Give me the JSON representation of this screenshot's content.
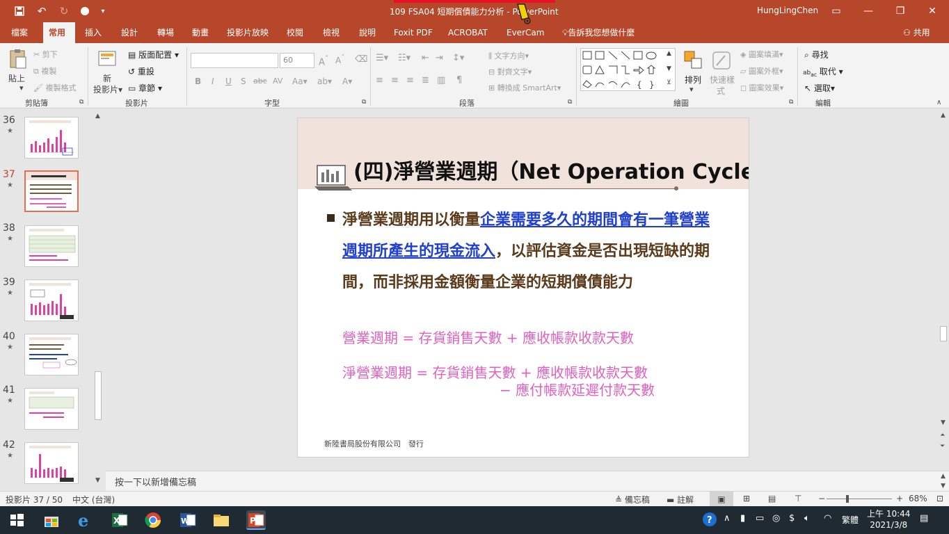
{
  "window": {
    "title": "109 FSA04 短期償債能力分析 - PowerPoint",
    "user": "HungLingChen"
  },
  "tabs": [
    "檔案",
    "常用",
    "插入",
    "設計",
    "轉場",
    "動畫",
    "投影片放映",
    "校閱",
    "檢視",
    "說明",
    "Foxit PDF",
    "ACROBAT",
    "EverCam"
  ],
  "tell_me": "告訴我您想做什麼",
  "share": "共用",
  "ribbon": {
    "clipboard": {
      "paste": "貼上",
      "cut": "剪下",
      "copy": "複製",
      "format_painter": "複製格式",
      "label": "剪貼簿"
    },
    "slides": {
      "new_slide": "新",
      "new_slide2": "投影片",
      "layout": "版面配置",
      "reset": "重設",
      "section": "章節",
      "label": "投影片"
    },
    "font": {
      "size": "60",
      "label": "字型"
    },
    "paragraph": {
      "text_direction": "文字方向",
      "align_text": "對齊文字",
      "smartart": "轉換成 SmartArt",
      "label": "段落"
    },
    "drawing": {
      "arrange": "排列",
      "quick_styles": "快速樣",
      "quick_styles2": "式",
      "shape_fill": "圖案填滿",
      "shape_outline": "圖案外框",
      "shape_effects": "圖案效果",
      "label": "繪圖"
    },
    "editing": {
      "find": "尋找",
      "replace": "取代",
      "select": "選取",
      "label": "編輯"
    }
  },
  "thumbnails": [
    {
      "num": "36",
      "star": "★"
    },
    {
      "num": "37",
      "star": "★"
    },
    {
      "num": "38",
      "star": "★"
    },
    {
      "num": "39",
      "star": "★"
    },
    {
      "num": "40",
      "star": "★"
    },
    {
      "num": "41",
      "star": "★"
    },
    {
      "num": "42",
      "star": "★"
    }
  ],
  "slide": {
    "title": "(四)淨營業週期（Net Operation Cycle）",
    "bullet_pre": "淨營業週期用以衡量",
    "bullet_hl": "企業需要多久的期間會有一筆營業週期所產生的現金流入",
    "bullet_post": "，以評估資金是否出現短缺的期間，而非採用金額衡量企業的短期償債能力",
    "formula1": "營業週期 = 存貨銷售天數 + 應收帳款收款天數",
    "formula2": "淨營業週期 = 存貨銷售天數 + 應收帳款收款天數",
    "formula3": "− 應付帳款延遲付款天數",
    "footer": "新陸書局股份有限公司　發行"
  },
  "notes_placeholder": "按一下以新增備忘稿",
  "status": {
    "slide_count": "投影片 37 / 50",
    "language": "中文 (台灣)",
    "notes": "備忘稿",
    "comments": "註解",
    "zoom": "68%"
  },
  "taskbar": {
    "time": "上午 10:44",
    "date": "2021/3/8",
    "ime": "繁體"
  }
}
